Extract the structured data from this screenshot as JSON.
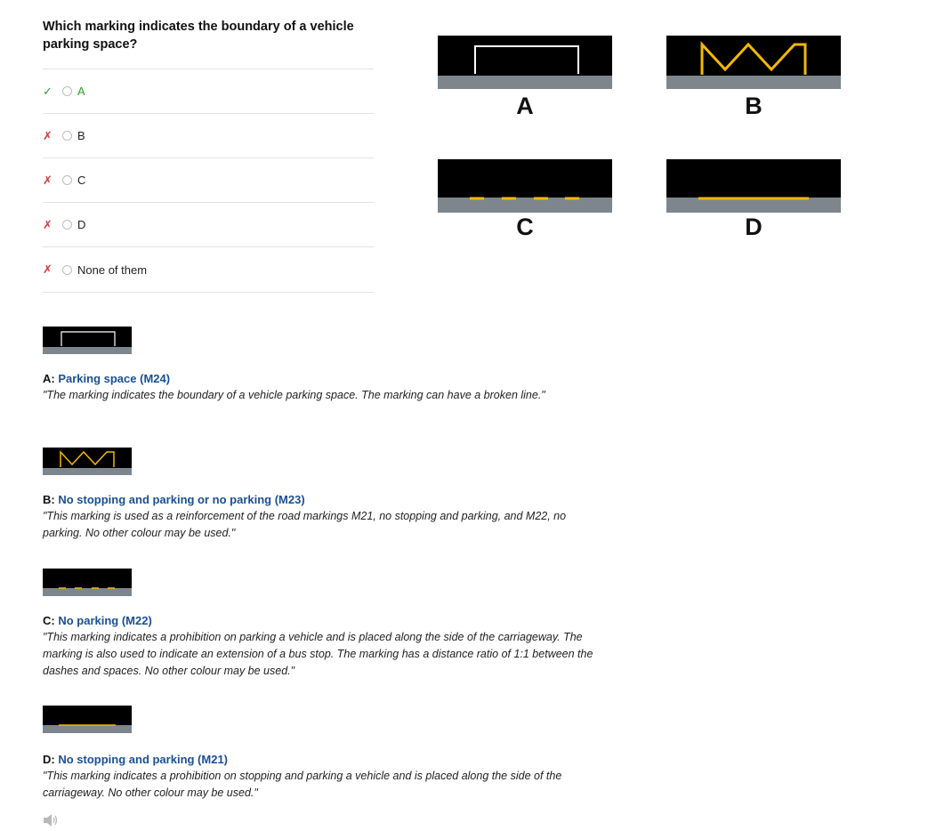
{
  "question": "Which marking indicates the boundary of a vehicle parking space?",
  "options": [
    {
      "label": "A",
      "status": "correct"
    },
    {
      "label": "B",
      "status": "wrong"
    },
    {
      "label": "C",
      "status": "wrong"
    },
    {
      "label": "D",
      "status": "wrong"
    },
    {
      "label": "None of them",
      "status": "wrong"
    }
  ],
  "icons": {
    "correct": "✓",
    "wrong": "✗"
  },
  "images": [
    {
      "label": "A",
      "marking": "white-rectangle"
    },
    {
      "label": "B",
      "marking": "yellow-zigzag"
    },
    {
      "label": "C",
      "marking": "yellow-dashed-line"
    },
    {
      "label": "D",
      "marking": "yellow-solid-line"
    }
  ],
  "explanations": [
    {
      "prefix": "A:",
      "title": "Parking space (M24)",
      "text": "\"The marking indicates the boundary of a vehicle parking space. The marking can have a broken line.\""
    },
    {
      "prefix": "B:",
      "title": "No stopping and parking or no parking (M23)",
      "text": "\"This marking is used as a reinforcement of the road markings M21, no stopping and parking, and M22, no parking. No other colour may be used.\""
    },
    {
      "prefix": "C:",
      "title": "No parking (M22)",
      "text": "\"This marking indicates a prohibition on parking a vehicle and is placed along the side of the carriageway. The marking is also used to indicate an extension of a bus stop. The marking has a distance ratio of 1:1 between the dashes and spaces. No other colour may be used.\""
    },
    {
      "prefix": "D:",
      "title": "No stopping and parking (M21)",
      "text": "\"This marking indicates a prohibition on stopping and parking a vehicle and is placed along the side of the carriageway. No other colour may be used.\""
    }
  ],
  "colors": {
    "road": "#000000",
    "kerb": "#7d868c",
    "yellow": "#f5b800",
    "white": "#ffffff",
    "link": "#1a4f95",
    "correct": "#2f9a2f",
    "wrong": "#d43c3c"
  },
  "audio": {
    "icon": "speaker-icon"
  }
}
